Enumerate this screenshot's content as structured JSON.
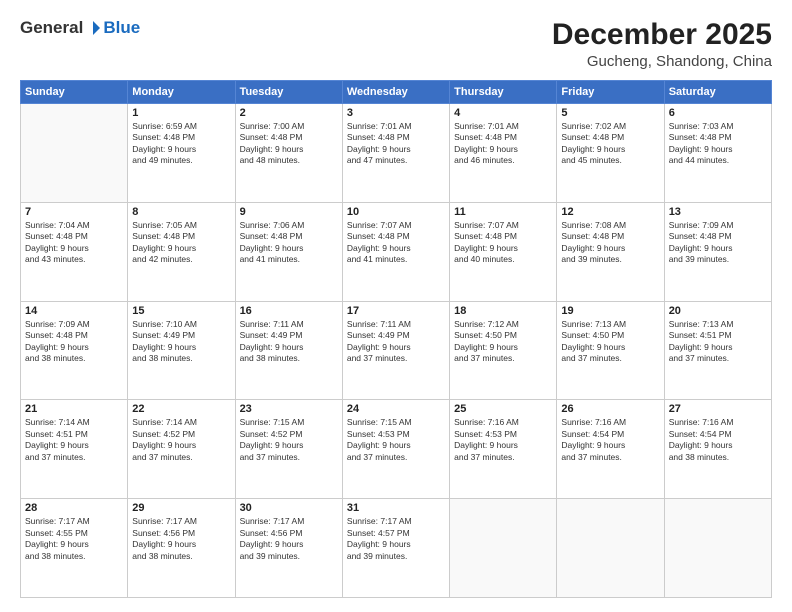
{
  "header": {
    "logo_general": "General",
    "logo_blue": "Blue",
    "month": "December 2025",
    "location": "Gucheng, Shandong, China"
  },
  "weekdays": [
    "Sunday",
    "Monday",
    "Tuesday",
    "Wednesday",
    "Thursday",
    "Friday",
    "Saturday"
  ],
  "weeks": [
    [
      {
        "day": "",
        "text": ""
      },
      {
        "day": "1",
        "text": "Sunrise: 6:59 AM\nSunset: 4:48 PM\nDaylight: 9 hours\nand 49 minutes."
      },
      {
        "day": "2",
        "text": "Sunrise: 7:00 AM\nSunset: 4:48 PM\nDaylight: 9 hours\nand 48 minutes."
      },
      {
        "day": "3",
        "text": "Sunrise: 7:01 AM\nSunset: 4:48 PM\nDaylight: 9 hours\nand 47 minutes."
      },
      {
        "day": "4",
        "text": "Sunrise: 7:01 AM\nSunset: 4:48 PM\nDaylight: 9 hours\nand 46 minutes."
      },
      {
        "day": "5",
        "text": "Sunrise: 7:02 AM\nSunset: 4:48 PM\nDaylight: 9 hours\nand 45 minutes."
      },
      {
        "day": "6",
        "text": "Sunrise: 7:03 AM\nSunset: 4:48 PM\nDaylight: 9 hours\nand 44 minutes."
      }
    ],
    [
      {
        "day": "7",
        "text": "Sunrise: 7:04 AM\nSunset: 4:48 PM\nDaylight: 9 hours\nand 43 minutes."
      },
      {
        "day": "8",
        "text": "Sunrise: 7:05 AM\nSunset: 4:48 PM\nDaylight: 9 hours\nand 42 minutes."
      },
      {
        "day": "9",
        "text": "Sunrise: 7:06 AM\nSunset: 4:48 PM\nDaylight: 9 hours\nand 41 minutes."
      },
      {
        "day": "10",
        "text": "Sunrise: 7:07 AM\nSunset: 4:48 PM\nDaylight: 9 hours\nand 41 minutes."
      },
      {
        "day": "11",
        "text": "Sunrise: 7:07 AM\nSunset: 4:48 PM\nDaylight: 9 hours\nand 40 minutes."
      },
      {
        "day": "12",
        "text": "Sunrise: 7:08 AM\nSunset: 4:48 PM\nDaylight: 9 hours\nand 39 minutes."
      },
      {
        "day": "13",
        "text": "Sunrise: 7:09 AM\nSunset: 4:48 PM\nDaylight: 9 hours\nand 39 minutes."
      }
    ],
    [
      {
        "day": "14",
        "text": "Sunrise: 7:09 AM\nSunset: 4:48 PM\nDaylight: 9 hours\nand 38 minutes."
      },
      {
        "day": "15",
        "text": "Sunrise: 7:10 AM\nSunset: 4:49 PM\nDaylight: 9 hours\nand 38 minutes."
      },
      {
        "day": "16",
        "text": "Sunrise: 7:11 AM\nSunset: 4:49 PM\nDaylight: 9 hours\nand 38 minutes."
      },
      {
        "day": "17",
        "text": "Sunrise: 7:11 AM\nSunset: 4:49 PM\nDaylight: 9 hours\nand 37 minutes."
      },
      {
        "day": "18",
        "text": "Sunrise: 7:12 AM\nSunset: 4:50 PM\nDaylight: 9 hours\nand 37 minutes."
      },
      {
        "day": "19",
        "text": "Sunrise: 7:13 AM\nSunset: 4:50 PM\nDaylight: 9 hours\nand 37 minutes."
      },
      {
        "day": "20",
        "text": "Sunrise: 7:13 AM\nSunset: 4:51 PM\nDaylight: 9 hours\nand 37 minutes."
      }
    ],
    [
      {
        "day": "21",
        "text": "Sunrise: 7:14 AM\nSunset: 4:51 PM\nDaylight: 9 hours\nand 37 minutes."
      },
      {
        "day": "22",
        "text": "Sunrise: 7:14 AM\nSunset: 4:52 PM\nDaylight: 9 hours\nand 37 minutes."
      },
      {
        "day": "23",
        "text": "Sunrise: 7:15 AM\nSunset: 4:52 PM\nDaylight: 9 hours\nand 37 minutes."
      },
      {
        "day": "24",
        "text": "Sunrise: 7:15 AM\nSunset: 4:53 PM\nDaylight: 9 hours\nand 37 minutes."
      },
      {
        "day": "25",
        "text": "Sunrise: 7:16 AM\nSunset: 4:53 PM\nDaylight: 9 hours\nand 37 minutes."
      },
      {
        "day": "26",
        "text": "Sunrise: 7:16 AM\nSunset: 4:54 PM\nDaylight: 9 hours\nand 37 minutes."
      },
      {
        "day": "27",
        "text": "Sunrise: 7:16 AM\nSunset: 4:54 PM\nDaylight: 9 hours\nand 38 minutes."
      }
    ],
    [
      {
        "day": "28",
        "text": "Sunrise: 7:17 AM\nSunset: 4:55 PM\nDaylight: 9 hours\nand 38 minutes."
      },
      {
        "day": "29",
        "text": "Sunrise: 7:17 AM\nSunset: 4:56 PM\nDaylight: 9 hours\nand 38 minutes."
      },
      {
        "day": "30",
        "text": "Sunrise: 7:17 AM\nSunset: 4:56 PM\nDaylight: 9 hours\nand 39 minutes."
      },
      {
        "day": "31",
        "text": "Sunrise: 7:17 AM\nSunset: 4:57 PM\nDaylight: 9 hours\nand 39 minutes."
      },
      {
        "day": "",
        "text": ""
      },
      {
        "day": "",
        "text": ""
      },
      {
        "day": "",
        "text": ""
      }
    ]
  ]
}
